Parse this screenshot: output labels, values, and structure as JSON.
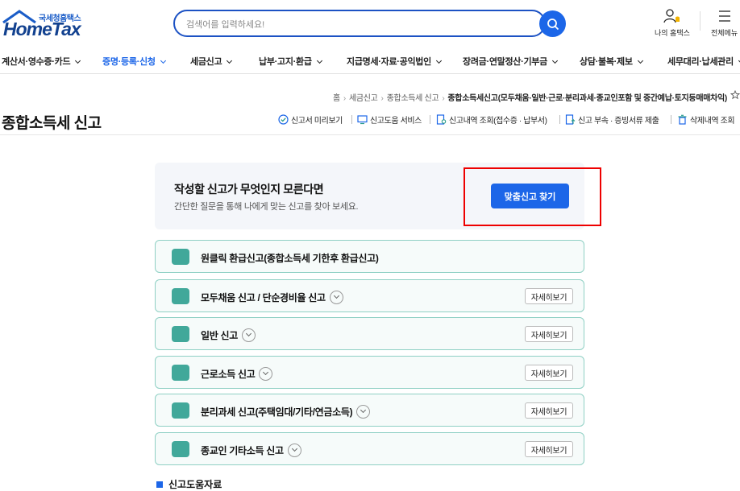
{
  "brand": {
    "small": "국세청홈택스",
    "name": "HomeTax"
  },
  "search": {
    "placeholder": "검색어를 입력하세요!"
  },
  "util": {
    "my_hometax": "나의 홈택스",
    "all_menu": "전체메뉴"
  },
  "gnb": [
    "계산서·영수증·카드",
    "증명·등록·신청",
    "세금신고",
    "납부·고지·환급",
    "지급명세·자료·공익법인",
    "장려금·연말정산·기부금",
    "상담·불복·제보",
    "세무대리·납세관리"
  ],
  "breadcrumb": {
    "home": "홈",
    "level1": "세금신고",
    "level2": "종합소득세 신고",
    "current": "종합소득세신고(모두채움·일반·근로·분리과세·종교인포함 및 중간예납·토지등매매차익)"
  },
  "page_title": "종합소득세 신고",
  "quick_links": [
    "신고서 미리보기",
    "신고도움 서비스",
    "신고내역 조회(접수증 · 납부서)",
    "신고 부속 · 증빙서류 제출",
    "삭제내역 조회"
  ],
  "guide": {
    "heading": "작성할 신고가 무엇인지 모른다면",
    "text": "간단한 질문을 통해 나에게 맞는 신고를 찾아 보세요.",
    "button": "맞춤신고 찾기"
  },
  "items": [
    {
      "label": "원클릭 환급신고(종합소득세 기한후 환급신고)"
    },
    {
      "label": "모두채움 신고 / 단순경비율 신고"
    },
    {
      "label": "일반 신고"
    },
    {
      "label": "근로소득 신고"
    },
    {
      "label": "분리과세 신고(주택임대/기타/연금소득)"
    },
    {
      "label": "종교인 기타소득 신고"
    }
  ],
  "detail_label": "자세히보기",
  "bottom_heading": "신고도움자료",
  "colors": {
    "accent": "#1c66e8",
    "brand_navy": "#12418f",
    "item_border": "#8fd0c4",
    "item_icon": "#41a89a",
    "highlight": "#e00000"
  }
}
